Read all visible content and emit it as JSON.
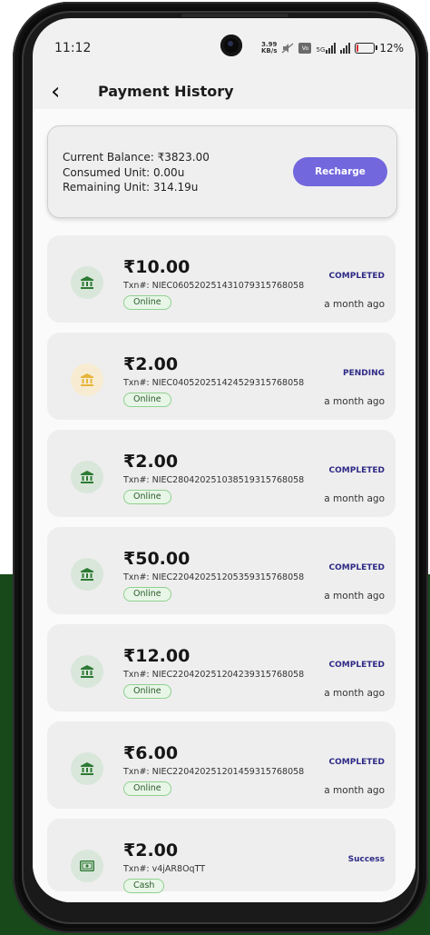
{
  "status_bar": {
    "time": "11:12",
    "speed_value": "3.99",
    "speed_unit": "KB/s",
    "network": "5G",
    "battery_percent": "12%",
    "battery_level": 0.12
  },
  "header": {
    "title": "Payment History"
  },
  "balance": {
    "current": "Current Balance: ₹3823.00",
    "consumed": "Consumed Unit: 0.00u",
    "remaining": "Remaining Unit: 314.19u",
    "recharge_label": "Recharge"
  },
  "transactions": [
    {
      "amount": "₹10.00",
      "txn": "Txn#: NIEC060520251431079315768058",
      "method": "Online",
      "status": "COMPLETED",
      "time": "a month ago",
      "icon": "bank-icon",
      "icon_color": "#2d7a34"
    },
    {
      "amount": "₹2.00",
      "txn": "Txn#: NIEC040520251424529315768058",
      "method": "Online",
      "status": "PENDING",
      "time": "a month ago",
      "icon": "bank-icon",
      "icon_color": "#e6b53a"
    },
    {
      "amount": "₹2.00",
      "txn": "Txn#: NIEC280420251038519315768058",
      "method": "Online",
      "status": "COMPLETED",
      "time": "a month ago",
      "icon": "bank-icon",
      "icon_color": "#2d7a34"
    },
    {
      "amount": "₹50.00",
      "txn": "Txn#: NIEC220420251205359315768058",
      "method": "Online",
      "status": "COMPLETED",
      "time": "a month ago",
      "icon": "bank-icon",
      "icon_color": "#2d7a34"
    },
    {
      "amount": "₹12.00",
      "txn": "Txn#: NIEC220420251204239315768058",
      "method": "Online",
      "status": "COMPLETED",
      "time": "a month ago",
      "icon": "bank-icon",
      "icon_color": "#2d7a34"
    },
    {
      "amount": "₹6.00",
      "txn": "Txn#: NIEC220420251201459315768058",
      "method": "Online",
      "status": "COMPLETED",
      "time": "a month ago",
      "icon": "bank-icon",
      "icon_color": "#2d7a34"
    },
    {
      "amount": "₹2.00",
      "txn": "Txn#: v4jAR8OqTT",
      "method": "Cash",
      "status": "Success",
      "time": "",
      "icon": "cash-icon",
      "icon_color": "#2d7a34"
    }
  ]
}
